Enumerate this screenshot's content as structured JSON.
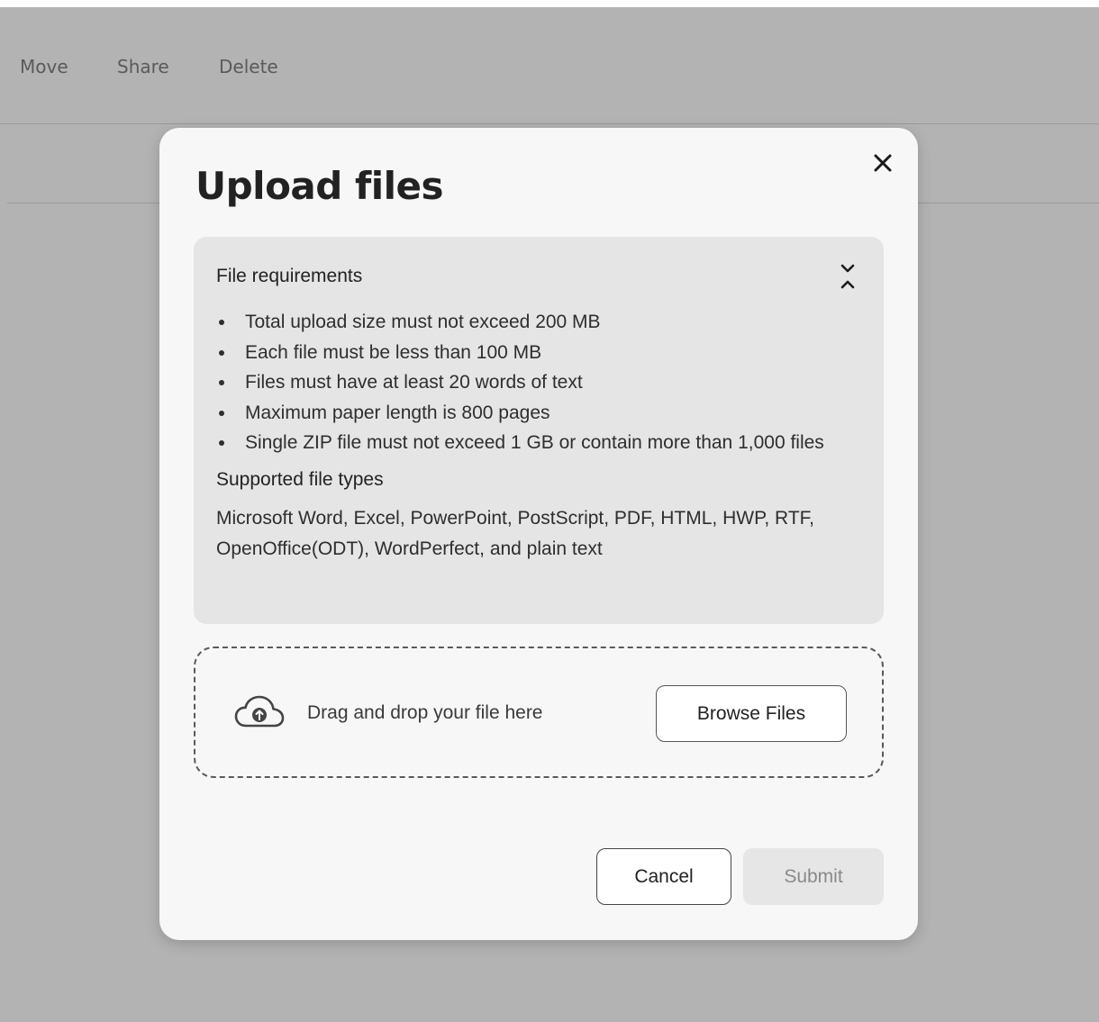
{
  "toolbar": {
    "move_label": "Move",
    "share_label": "Share",
    "delete_label": "Delete"
  },
  "modal": {
    "title": "Upload files",
    "close_icon": "close-icon",
    "requirements": {
      "title": "File requirements",
      "toggle_icon": "collapse-chevrons-icon",
      "items": [
        "Total upload size must not exceed 200 MB",
        "Each file must be less than 100 MB",
        "Files must have at least 20 words of text",
        "Maximum paper length is 800 pages",
        "Single ZIP file must not exceed 1 GB or contain more than 1,000 files"
      ],
      "types_title": "Supported file types",
      "types_text": "Microsoft Word, Excel, PowerPoint, PostScript, PDF, HTML, HWP, RTF, OpenOffice(ODT), WordPerfect, and plain text"
    },
    "dropzone": {
      "icon": "cloud-upload-icon",
      "text": "Drag and drop your file here",
      "browse_label": "Browse Files"
    },
    "actions": {
      "cancel_label": "Cancel",
      "submit_label": "Submit"
    }
  },
  "colors": {
    "overlay": "#b3b3b3",
    "modal_bg": "#f7f7f7",
    "requirements_bg": "#e5e5e5",
    "submit_disabled_bg": "#e6e6e6",
    "submit_disabled_text": "#8a8a8a"
  }
}
